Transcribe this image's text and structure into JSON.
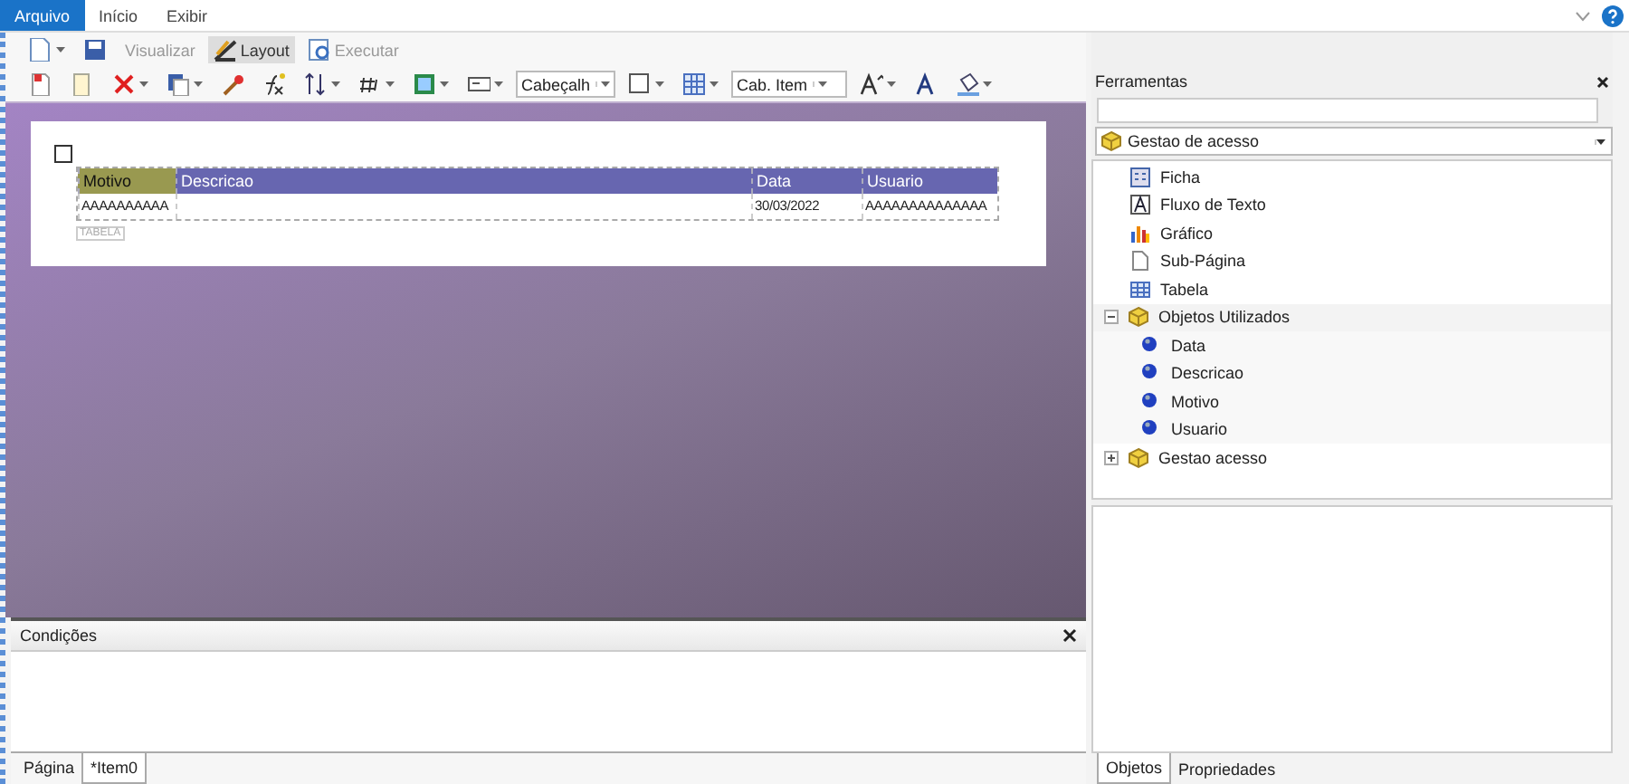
{
  "menu": [
    {
      "label": "Arquivo",
      "selected": true
    },
    {
      "label": "Início",
      "selected": false
    },
    {
      "label": "Exibir",
      "selected": false
    }
  ],
  "toolbar": {
    "modes": [
      {
        "label": "Visualizar",
        "selected": false,
        "disabled": true
      },
      {
        "label": "Layout",
        "selected": true,
        "disabled": false
      },
      {
        "label": "Executar",
        "selected": false,
        "disabled": true
      }
    ],
    "section_dropdown": {
      "value": "Cabeçalh"
    },
    "band_dropdown": {
      "value": "Cab. Item"
    }
  },
  "report": {
    "table": {
      "label": "TABELA",
      "columns": [
        {
          "label": "Motivo",
          "selected": true,
          "cell": "AAAAAAAAAA"
        },
        {
          "label": "Descricao",
          "selected": false
        },
        {
          "label": "Data",
          "selected": false,
          "cell": "30/03/2022"
        },
        {
          "label": "Usuario",
          "selected": false,
          "cell": "AAAAAAAAAAAAAA"
        }
      ]
    }
  },
  "conditions": {
    "title": "Condições",
    "tabs": [
      {
        "label": "Página",
        "selected": false
      },
      {
        "label": "*Item0",
        "selected": true
      }
    ]
  },
  "tools": {
    "title": "Ferramentas",
    "source": "Gestao de acesso",
    "tree": [
      {
        "label": "Ficha",
        "kind": "form"
      },
      {
        "label": "Fluxo de Texto",
        "kind": "text"
      },
      {
        "label": "Gráfico",
        "kind": "chart"
      },
      {
        "label": "Sub-Página",
        "kind": "page"
      },
      {
        "label": "Tabela",
        "kind": "table"
      },
      {
        "label": "Objetos Utilizados",
        "kind": "group",
        "expanded": true,
        "children": [
          {
            "label": "Data",
            "kind": "field"
          },
          {
            "label": "Descricao",
            "kind": "field"
          },
          {
            "label": "Motivo",
            "kind": "field"
          },
          {
            "label": "Usuario",
            "kind": "field"
          }
        ]
      },
      {
        "label": "Gestao acesso",
        "kind": "group",
        "expanded": false
      }
    ],
    "tabs": [
      {
        "label": "Objetos",
        "selected": true
      },
      {
        "label": "Propriedades",
        "selected": false
      }
    ]
  }
}
